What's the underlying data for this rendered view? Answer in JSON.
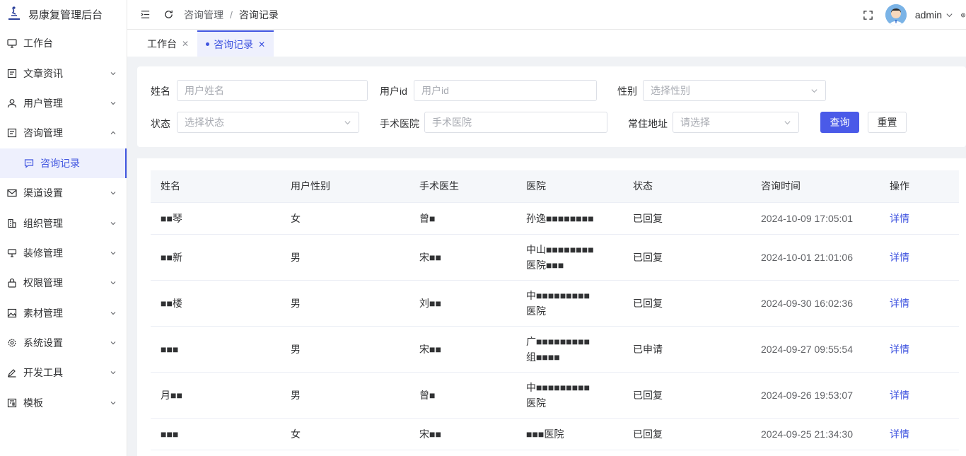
{
  "app": {
    "title": "易康复管理后台"
  },
  "sidebar": {
    "items": [
      {
        "label": "工作台",
        "icon": "monitor-icon",
        "has_arrow": false
      },
      {
        "label": "文章资讯",
        "icon": "article-icon",
        "has_arrow": true
      },
      {
        "label": "用户管理",
        "icon": "user-icon",
        "has_arrow": true
      },
      {
        "label": "咨询管理",
        "icon": "consult-icon",
        "has_arrow": true,
        "expanded": true
      },
      {
        "label": "咨询记录",
        "icon": "chat-icon",
        "sub": true,
        "active": true
      },
      {
        "label": "渠道设置",
        "icon": "mail-icon",
        "has_arrow": true
      },
      {
        "label": "组织管理",
        "icon": "org-icon",
        "has_arrow": true
      },
      {
        "label": "装修管理",
        "icon": "decorate-icon",
        "has_arrow": true
      },
      {
        "label": "权限管理",
        "icon": "lock-icon",
        "has_arrow": true
      },
      {
        "label": "素材管理",
        "icon": "image-icon",
        "has_arrow": true
      },
      {
        "label": "系统设置",
        "icon": "gear-icon",
        "has_arrow": true
      },
      {
        "label": "开发工具",
        "icon": "pen-icon",
        "has_arrow": true
      },
      {
        "label": "模板",
        "icon": "template-icon",
        "has_arrow": true
      }
    ]
  },
  "header": {
    "breadcrumb": [
      "咨询管理",
      "咨询记录"
    ],
    "breadcrumb_sep": "/",
    "username": "admin"
  },
  "tabs": [
    {
      "label": "工作台",
      "active": false
    },
    {
      "label": "咨询记录",
      "active": true
    }
  ],
  "search": {
    "name_label": "姓名",
    "name_placeholder": "用户姓名",
    "userid_label": "用户id",
    "userid_placeholder": "用户id",
    "gender_label": "性别",
    "gender_placeholder": "选择性别",
    "status_label": "状态",
    "status_placeholder": "选择状态",
    "hospital_label": "手术医院",
    "hospital_placeholder": "手术医院",
    "address_label": "常住地址",
    "address_placeholder": "请选择",
    "query_button": "查询",
    "reset_button": "重置"
  },
  "table": {
    "columns": [
      "姓名",
      "用户性别",
      "手术医生",
      "医院",
      "状态",
      "咨询时间",
      "操作"
    ],
    "rows": [
      {
        "name": "■■琴",
        "gender": "女",
        "doctor": "曾■",
        "hospital": [
          "孙逸■■■■■■■■"
        ],
        "status": "已回复",
        "time": "2024-10-09 17:05:01",
        "action": "详情"
      },
      {
        "name": "■■新",
        "gender": "男",
        "doctor": "宋■■",
        "hospital": [
          "中山■■■■■■■■",
          "医院■■■"
        ],
        "status": "已回复",
        "time": "2024-10-01 21:01:06",
        "action": "详情"
      },
      {
        "name": "■■楼",
        "gender": "男",
        "doctor": "刘■■",
        "hospital": [
          "中■■■■■■■■■",
          "医院"
        ],
        "status": "已回复",
        "time": "2024-09-30 16:02:36",
        "action": "详情"
      },
      {
        "name": "■■■",
        "gender": "男",
        "doctor": "宋■■",
        "hospital": [
          "广■■■■■■■■■",
          "组■■■■"
        ],
        "status": "已申请",
        "time": "2024-09-27 09:55:54",
        "action": "详情"
      },
      {
        "name": "月■■",
        "gender": "男",
        "doctor": "曾■",
        "hospital": [
          "中■■■■■■■■■",
          "医院"
        ],
        "status": "已回复",
        "time": "2024-09-26 19:53:07",
        "action": "详情"
      },
      {
        "name": "■■■",
        "gender": "女",
        "doctor": "宋■■",
        "hospital": [
          "■■■医院"
        ],
        "status": "已回复",
        "time": "2024-09-25 21:34:30",
        "action": "详情"
      }
    ]
  },
  "colors": {
    "accent": "#4055e0",
    "primary_button": "#4a5ae8",
    "background": "#f0f2f5"
  }
}
